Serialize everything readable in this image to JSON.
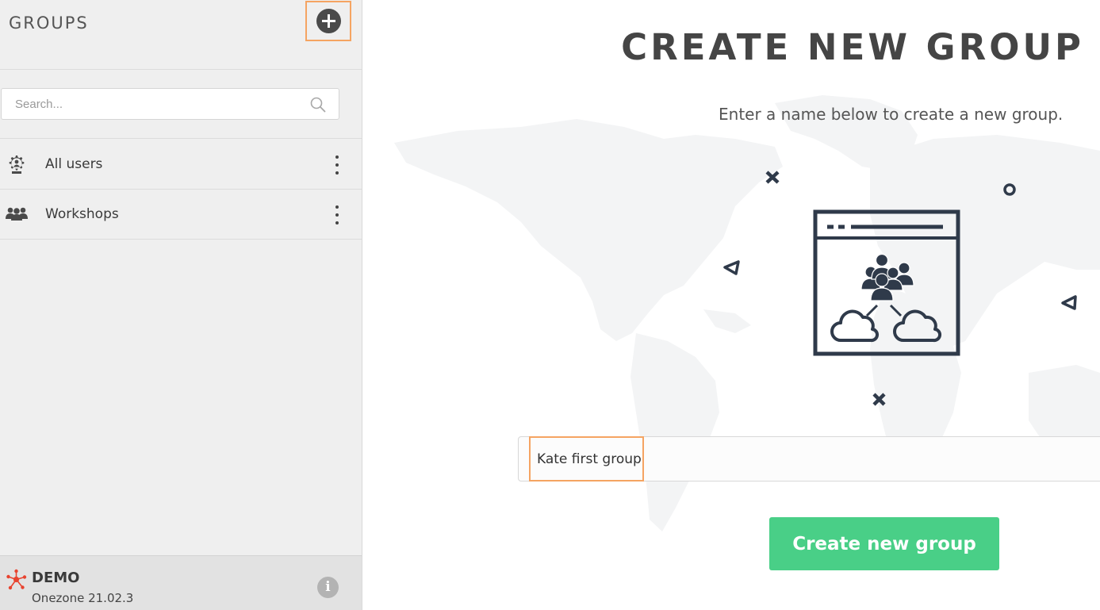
{
  "sidebar": {
    "title": "GROUPS",
    "add_icon": "plus-circle-icon",
    "search": {
      "placeholder": "Search...",
      "value": "",
      "icon": "search-icon"
    },
    "items": [
      {
        "label": "All users",
        "icon": "gear-user-icon",
        "menu_icon": "vertical-dots-icon"
      },
      {
        "label": "Workshops",
        "icon": "users-group-icon",
        "menu_icon": "vertical-dots-icon"
      }
    ],
    "footer": {
      "logo_icon": "onezone-logo-icon",
      "name": "DEMO",
      "version": "Onezone 21.02.3",
      "info_icon": "info-icon"
    }
  },
  "main": {
    "title": "CREATE NEW GROUP",
    "subtitle": "Enter a name below to create a new group.",
    "name_input": {
      "value": "Kate first group",
      "placeholder": ""
    },
    "create_button": "Create new group"
  },
  "colors": {
    "accent_green": "#49cf87",
    "highlight_orange": "#f5a462",
    "illustration_dark": "#2f3a4a",
    "logo_red": "#e8432f"
  }
}
